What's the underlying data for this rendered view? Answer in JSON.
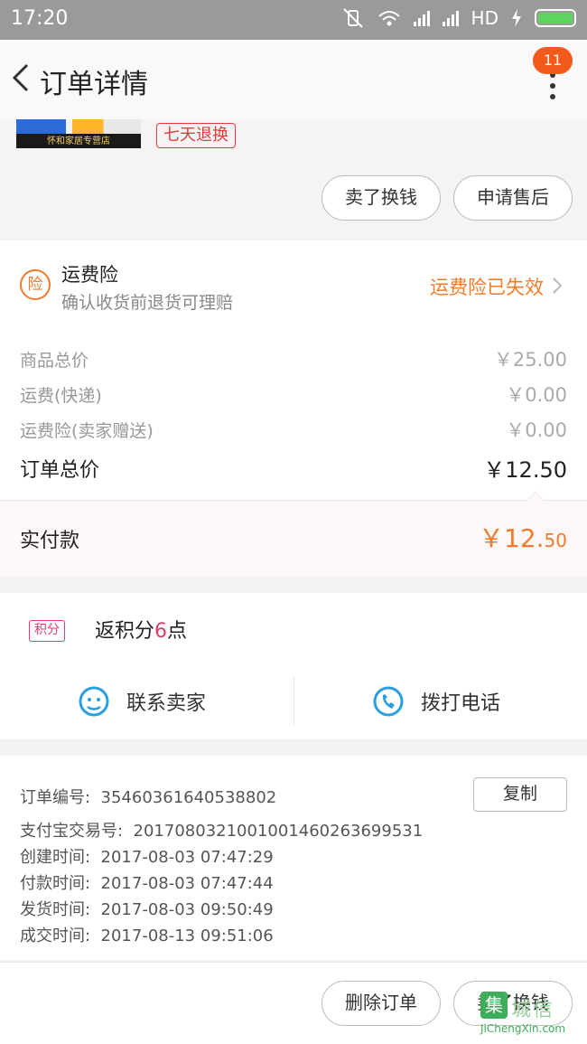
{
  "status_bar": {
    "time": "17:20",
    "network": "HD"
  },
  "nav": {
    "title": "订单详情",
    "badge": "11"
  },
  "goods": {
    "store_name": "怀和家居专营店",
    "tag": "七天退换",
    "sell_button": "卖了换钱",
    "after_sale_button": "申请售后"
  },
  "insurance": {
    "icon": "险",
    "title": "运费险",
    "subtitle": "确认收货前退货可理赔",
    "status": "运费险已失效"
  },
  "price": {
    "rows": [
      {
        "label": "商品总价",
        "value": "￥25.00"
      },
      {
        "label": "运费(快递)",
        "value": "￥0.00"
      },
      {
        "label": "运费险(卖家赠送)",
        "value": "￥0.00"
      }
    ],
    "total_label": "订单总价",
    "total_value": "￥12.50",
    "paid_label": "实付款",
    "paid_int": "￥12.",
    "paid_dec": "50"
  },
  "points": {
    "tag": "积分",
    "text_prefix": "返积分",
    "num": "6",
    "text_suffix": "点"
  },
  "actions": {
    "contact_seller": "联系卖家",
    "call": "拨打电话"
  },
  "info": {
    "copy_button": "复制",
    "lines": [
      {
        "label": "订单编号:",
        "value": "35460361640538802"
      },
      {
        "label": "支付宝交易号:",
        "value": "2017080321001001460263699531"
      },
      {
        "label": "创建时间:",
        "value": "2017-08-03 07:47:29"
      },
      {
        "label": "付款时间:",
        "value": "2017-08-03 07:47:44"
      },
      {
        "label": "发货时间:",
        "value": "2017-08-03 09:50:49"
      },
      {
        "label": "成交时间:",
        "value": "2017-08-13 09:51:06"
      }
    ]
  },
  "bottom": {
    "delete_button": "删除订单",
    "sell_button": "卖了换钱"
  },
  "watermark": {
    "logo": "集",
    "cn": "城信",
    "en": "JiChengXin.com"
  },
  "colors": {
    "accent": "#f07b2a",
    "badge": "#f25a1c",
    "tag_red": "#e23b3b",
    "points_pink": "#e23b6b"
  }
}
